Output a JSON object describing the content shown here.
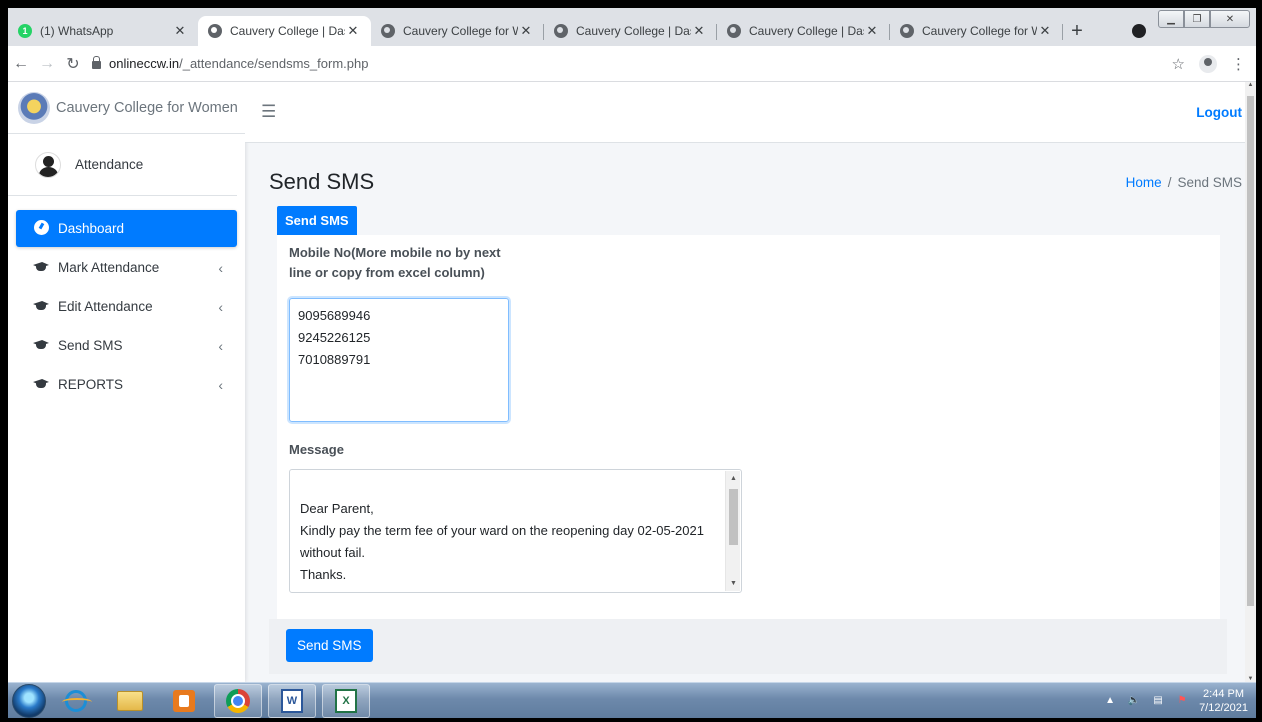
{
  "browser": {
    "tabs": [
      {
        "title": "(1) WhatsApp",
        "favicon": "whatsapp-icon",
        "badge": "1"
      },
      {
        "title": "Cauvery College | Dashb",
        "favicon": "globe-icon",
        "active": true
      },
      {
        "title": "Cauvery College for Wo",
        "favicon": "globe-icon"
      },
      {
        "title": "Cauvery College | Dashb",
        "favicon": "globe-icon"
      },
      {
        "title": "Cauvery College | Dashb",
        "favicon": "globe-icon"
      },
      {
        "title": "Cauvery College for Wo",
        "favicon": "globe-icon"
      }
    ],
    "tab_close": "✕",
    "new_tab": "+",
    "url_host": "onlineccw.in",
    "url_path": "/_attendance/sendsms_form.php"
  },
  "sidebar": {
    "brand": "Cauvery College for Women",
    "user": "Attendance",
    "items": [
      {
        "label": "Dashboard",
        "icon": "dashboard-icon",
        "active": true
      },
      {
        "label": "Mark Attendance",
        "icon": "graduation-cap-icon",
        "chevron": "‹"
      },
      {
        "label": "Edit Attendance",
        "icon": "graduation-cap-icon",
        "chevron": "‹"
      },
      {
        "label": "Send SMS",
        "icon": "graduation-cap-icon",
        "chevron": "‹"
      },
      {
        "label": "REPORTS",
        "icon": "graduation-cap-icon",
        "chevron": "‹"
      }
    ]
  },
  "header": {
    "menu_icon": "☰",
    "logout": "Logout",
    "page_title": "Send SMS",
    "breadcrumb_home": "Home",
    "breadcrumb_sep": "/",
    "breadcrumb_current": "Send SMS"
  },
  "form": {
    "tab_label": "Send SMS",
    "mobile_label": "Mobile No(More mobile no by next line or copy from excel column)",
    "mobile_value": "9095689946\n9245226125\n7010889791",
    "message_label": "Message",
    "message_value": "Dear Parent,\nKindly pay the term fee of your ward on the reopening day 02-05-2021 without fail.\nThanks.\nPRINCIPAL",
    "submit_label": "Send SMS"
  },
  "taskbar": {
    "time": "2:44 PM",
    "date": "7/12/2021",
    "word_glyph": "W",
    "excel_glyph": "X"
  },
  "colors": {
    "primary": "#007bff",
    "sidebar_bg": "#ffffff",
    "content_bg": "#f4f6f9"
  }
}
